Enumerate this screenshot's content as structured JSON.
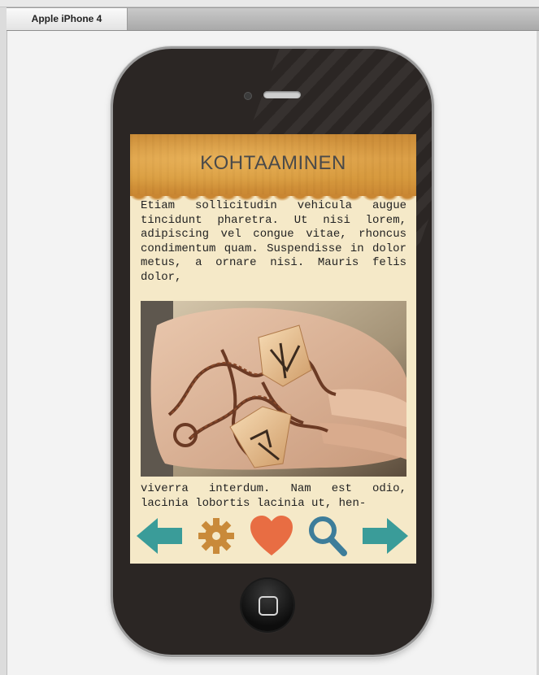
{
  "simulator": {
    "tab_label": "Apple iPhone 4"
  },
  "app": {
    "title": "KOHTAAMINEN",
    "paragraph_top": "Etiam sollicitudin vehicula augue tincidunt pharetra. Ut nisi lorem, adipiscing vel congue vitae, rhoncus condimentum quam. Suspendisse in dolor metus, a ornare nisi. Mauris felis dolor,",
    "paragraph_bottom": "viverra interdum. Nam est odio, lacinia lobortis lacinia ut, hen-"
  },
  "nav_icons": [
    "arrow-left-icon",
    "gear-icon",
    "heart-icon",
    "search-icon",
    "arrow-right-icon"
  ],
  "colors": {
    "teal": "#3a9c99",
    "gear": "#c98a3a",
    "heart": "#e86d43",
    "search": "#3d7d9a",
    "header": "#d79a3e",
    "paper": "#f5e9c8"
  }
}
